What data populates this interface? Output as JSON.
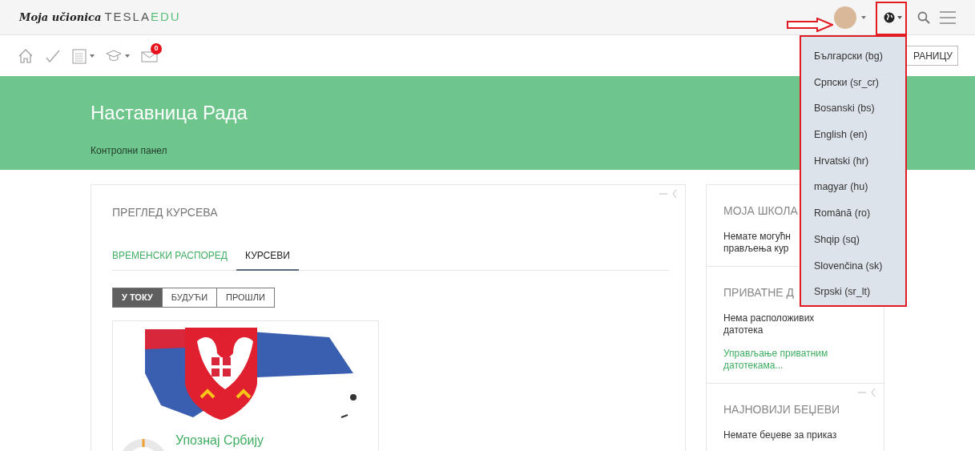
{
  "header": {
    "logo_script": "Moja učionica",
    "logo_brand": "TESLA",
    "logo_brand_accent": "EDU"
  },
  "toolbar": {
    "mail_badge": "0",
    "page_button": "РАНИЦУ"
  },
  "banner": {
    "title": "Наставница Рада",
    "subtitle": "Контролни панел"
  },
  "course_overview": {
    "title": "ПРЕГЛЕД КУРСЕВА",
    "tabs": [
      {
        "label": "ВРЕМЕНСКИ РАСПОРЕД",
        "selected": false
      },
      {
        "label": "КУРСЕВИ",
        "selected": true
      }
    ],
    "filters": [
      {
        "label": "У ТОКУ",
        "selected": true
      },
      {
        "label": "БУДУЋИ",
        "selected": false
      },
      {
        "label": "ПРОШЛИ",
        "selected": false
      }
    ],
    "courses": [
      {
        "name": "Упознај Србију"
      }
    ]
  },
  "sidebar": [
    {
      "title": "МОЈА ШКОЛА",
      "lines": [
        "Немате могућн",
        "прављења кур"
      ],
      "controls": false
    },
    {
      "title": "ПРИВАТНЕ Д",
      "lines": [
        "Нема расположивих датотека"
      ],
      "link": "Управљање приватним датотекама...",
      "controls": false
    },
    {
      "title": "НАЈНОВИЈИ БЕЏЕВИ",
      "lines": [
        "Немате беџеве за приказ"
      ],
      "controls": true
    }
  ],
  "language_menu": [
    "Български (bg)",
    "Српски (sr_cr)",
    "Bosanski (bs)",
    "English (en)",
    "Hrvatski (hr)",
    "magyar (hu)",
    "Română (ro)",
    "Shqip (sq)",
    "Slovenčina (sk)",
    "Srpski (sr_lt)"
  ]
}
